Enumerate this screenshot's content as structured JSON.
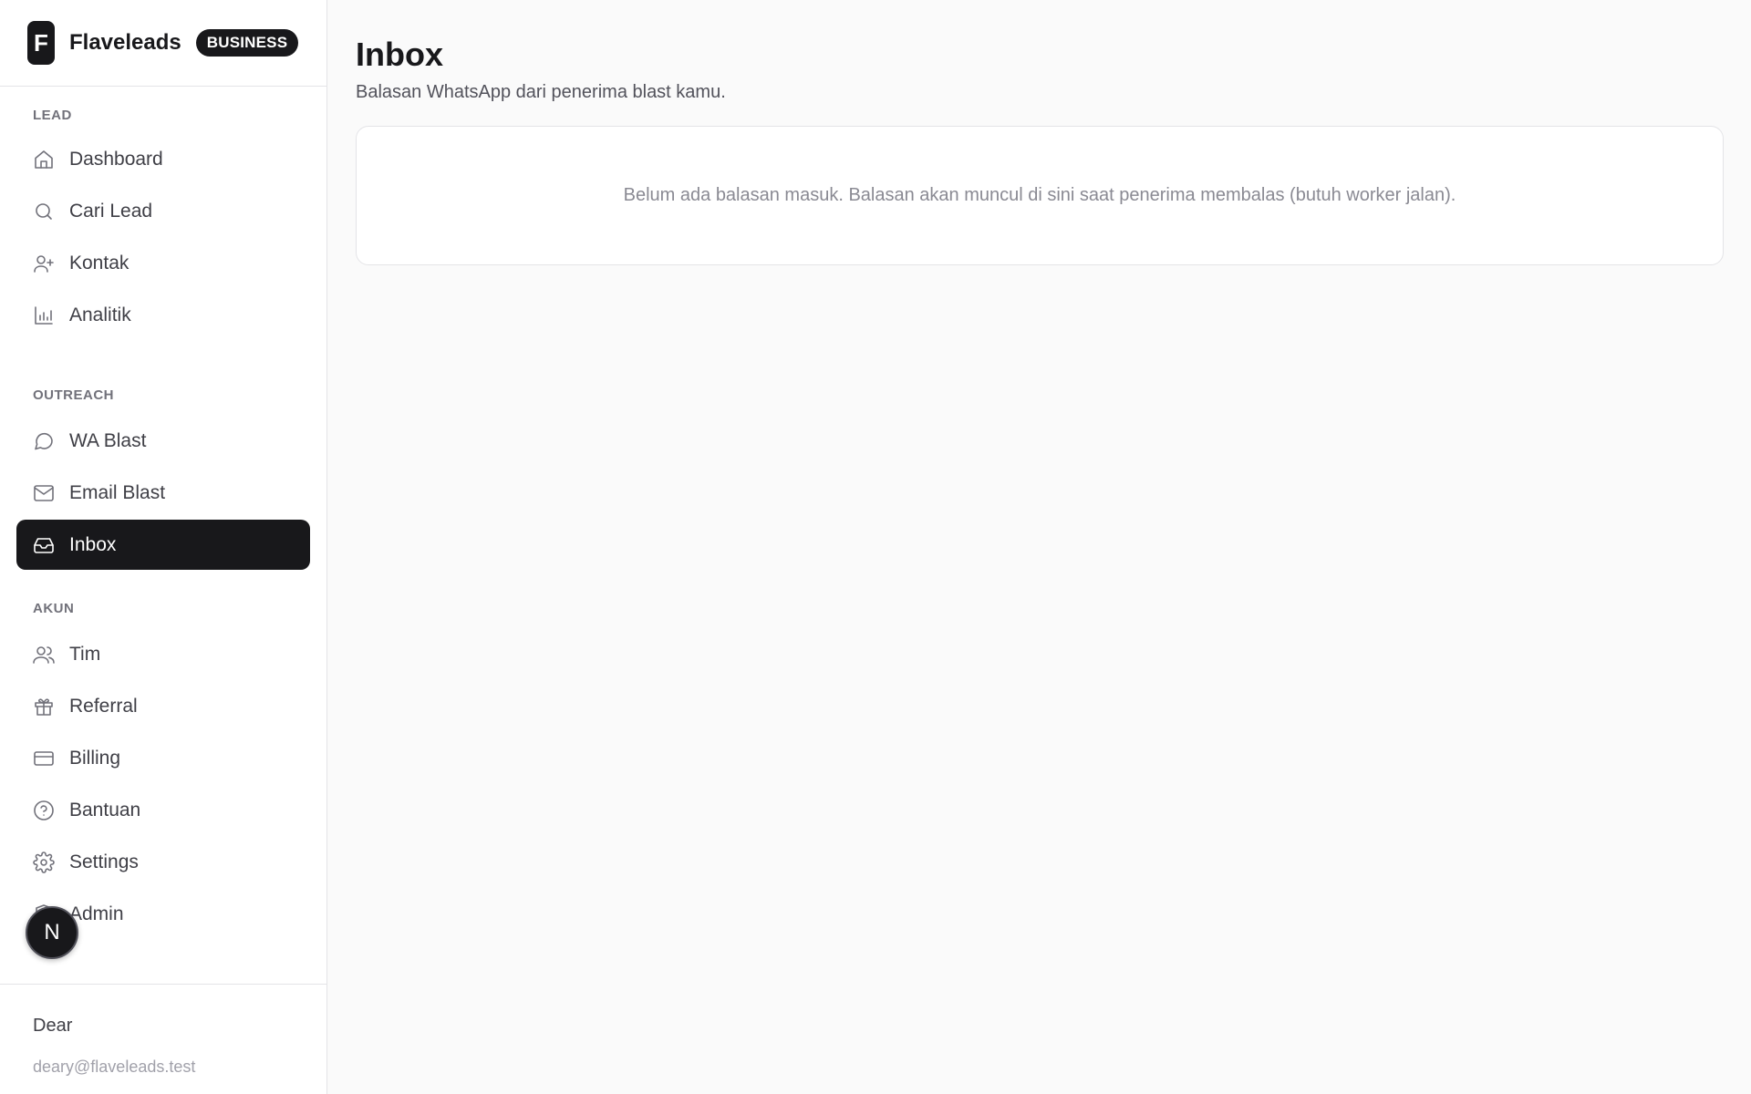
{
  "brand": {
    "logo_letter": "F",
    "name": "Flaveleads",
    "plan": "BUSINESS"
  },
  "sidebar": {
    "sections": [
      {
        "label": "LEAD",
        "items": [
          {
            "label": "Dashboard",
            "icon": "home-icon"
          },
          {
            "label": "Cari Lead",
            "icon": "search-icon"
          },
          {
            "label": "Kontak",
            "icon": "user-plus-icon"
          },
          {
            "label": "Analitik",
            "icon": "bar-chart-icon"
          }
        ]
      },
      {
        "label": "OUTREACH",
        "items": [
          {
            "label": "WA Blast",
            "icon": "message-circle-icon"
          },
          {
            "label": "Email Blast",
            "icon": "mail-icon"
          },
          {
            "label": "Inbox",
            "icon": "inbox-icon",
            "active": true
          }
        ]
      },
      {
        "label": "AKUN",
        "items": [
          {
            "label": "Tim",
            "icon": "users-icon"
          },
          {
            "label": "Referral",
            "icon": "gift-icon"
          },
          {
            "label": "Billing",
            "icon": "credit-card-icon"
          },
          {
            "label": "Bantuan",
            "icon": "help-circle-icon"
          },
          {
            "label": "Settings",
            "icon": "gear-icon"
          },
          {
            "label": "Admin",
            "icon": "shield-icon"
          }
        ]
      }
    ]
  },
  "user": {
    "name": "Dear",
    "email": "deary@flaveleads.test",
    "avatar_letter": "N"
  },
  "page": {
    "title": "Inbox",
    "subtitle": "Balasan WhatsApp dari penerima blast kamu.",
    "empty_message": "Belum ada balasan masuk. Balasan akan muncul di sini saat penerima membalas (butuh worker jalan)."
  }
}
